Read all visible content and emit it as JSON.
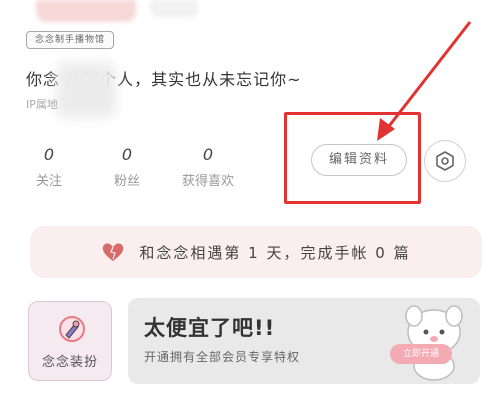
{
  "profile": {
    "tag": "念念制手播物馆",
    "signature": "你念      的那个人，其实也从未忘记你~",
    "ip_label": "IP属地"
  },
  "stats": [
    {
      "value": "0",
      "label": "关注"
    },
    {
      "value": "0",
      "label": "粉丝"
    },
    {
      "value": "0",
      "label": "获得喜欢"
    }
  ],
  "actions": {
    "edit_profile": "编辑资料"
  },
  "days_banner": {
    "text": "和念念相遇第 1 天，完成手帐 0 篇"
  },
  "dress_up": {
    "label": "念念装扮"
  },
  "promo": {
    "title": "太便宜了吧!!",
    "subtitle": "开通拥有全部会员专享特权",
    "button": "立即开通"
  },
  "colors": {
    "annotation_red": "#e23333",
    "banner_pink": "#fbeeee",
    "promo_button": "#f3aab3"
  }
}
